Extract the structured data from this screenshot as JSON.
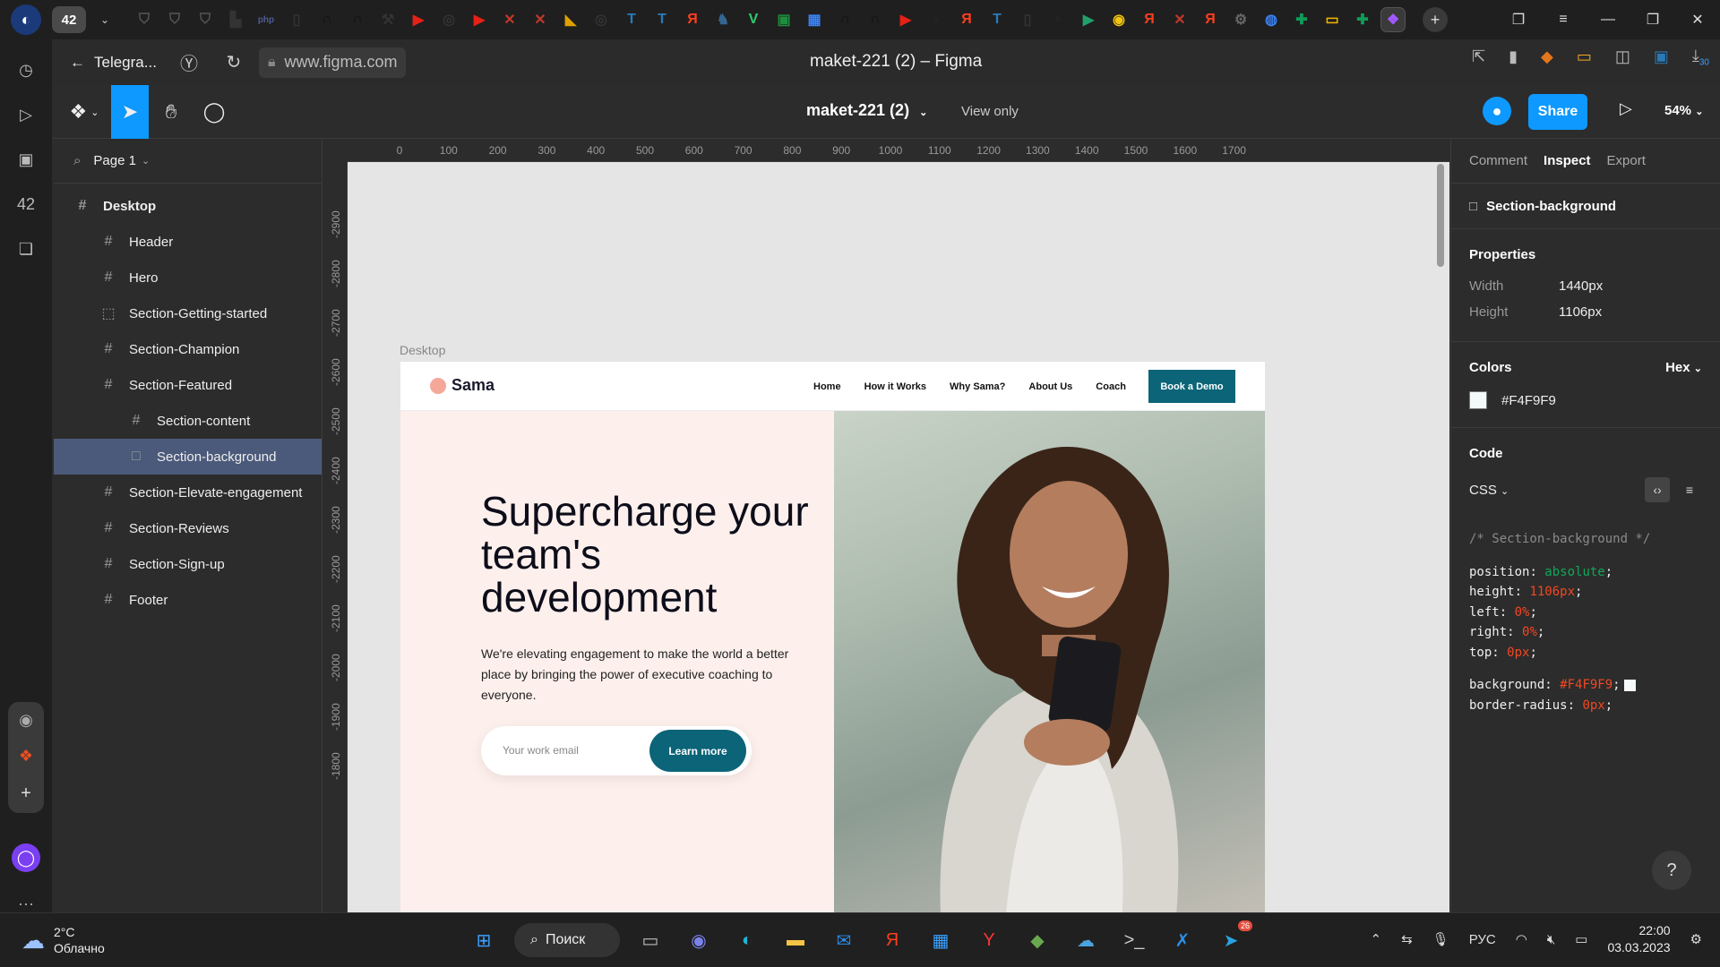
{
  "browser": {
    "tab_count": "42",
    "pinned_tabs": [
      {
        "icon": "shield-icon",
        "glyph": "⛉",
        "color": "#555"
      },
      {
        "icon": "shield-icon",
        "glyph": "⛉",
        "color": "#555"
      },
      {
        "icon": "shield-icon",
        "glyph": "⛉",
        "color": "#555"
      },
      {
        "icon": "chart-icon",
        "glyph": "▙",
        "color": "#333"
      },
      {
        "icon": "php-icon",
        "glyph": "php",
        "color": "#4f5b93"
      },
      {
        "icon": "document-icon",
        "glyph": "▯",
        "color": "#333"
      },
      {
        "icon": "n-icon",
        "glyph": "∩",
        "color": "#111"
      },
      {
        "icon": "n-icon",
        "glyph": "∩",
        "color": "#111"
      },
      {
        "icon": "tool-icon",
        "glyph": "⚒",
        "color": "#333"
      },
      {
        "icon": "youtube-icon",
        "glyph": "▶",
        "color": "#e62117"
      },
      {
        "icon": "circle-icon",
        "glyph": "◎",
        "color": "#333"
      },
      {
        "icon": "youtube-icon",
        "glyph": "▶",
        "color": "#e62117"
      },
      {
        "icon": "figure-icon",
        "glyph": "✕",
        "color": "#c0392b"
      },
      {
        "icon": "figure-icon",
        "glyph": "✕",
        "color": "#c0392b"
      },
      {
        "icon": "chart-icon",
        "glyph": "◣",
        "color": "#e0a000"
      },
      {
        "icon": "circle-icon",
        "glyph": "◎",
        "color": "#333"
      },
      {
        "icon": "t-icon",
        "glyph": "T",
        "color": "#2a7ab8"
      },
      {
        "icon": "t-icon",
        "glyph": "T",
        "color": "#2a7ab8"
      },
      {
        "icon": "yandex-icon",
        "glyph": "Я",
        "color": "#fc3f1d"
      },
      {
        "icon": "elephant-icon",
        "glyph": "♞",
        "color": "#336791"
      },
      {
        "icon": "v-icon",
        "glyph": "V",
        "color": "#2ecc71"
      },
      {
        "icon": "code-icon",
        "glyph": "▣",
        "color": "#1e8e3e"
      },
      {
        "icon": "image-icon",
        "glyph": "▦",
        "color": "#3b82f6"
      },
      {
        "icon": "n-icon",
        "glyph": "∩",
        "color": "#111"
      },
      {
        "icon": "n-icon",
        "glyph": "∩",
        "color": "#111"
      },
      {
        "icon": "youtube-icon",
        "glyph": "▶",
        "color": "#e62117"
      },
      {
        "icon": "github-icon",
        "glyph": "●",
        "color": "#222"
      },
      {
        "icon": "yandex-icon",
        "glyph": "Я",
        "color": "#fc3f1d"
      },
      {
        "icon": "t-icon",
        "glyph": "T",
        "color": "#2a7ab8"
      },
      {
        "icon": "document-icon",
        "glyph": "▯",
        "color": "#333"
      },
      {
        "icon": "github-icon",
        "glyph": "●",
        "color": "#222"
      },
      {
        "icon": "play-icon",
        "glyph": "▶",
        "color": "#22a06b"
      },
      {
        "icon": "coin-icon",
        "glyph": "◉",
        "color": "#f1c40f"
      },
      {
        "icon": "yandex-icon",
        "glyph": "Я",
        "color": "#fc3f1d"
      },
      {
        "icon": "figure-icon",
        "glyph": "✕",
        "color": "#c0392b"
      },
      {
        "icon": "yandex-icon",
        "glyph": "Я",
        "color": "#fc3f1d"
      },
      {
        "icon": "gear-icon",
        "glyph": "⚙",
        "color": "#666"
      },
      {
        "icon": "globe-icon",
        "glyph": "◍",
        "color": "#3b82f6"
      },
      {
        "icon": "sheets-icon",
        "glyph": "✚",
        "color": "#0f9d58"
      },
      {
        "icon": "slides-icon",
        "glyph": "▭",
        "color": "#f4b400"
      },
      {
        "icon": "sheets-icon",
        "glyph": "✚",
        "color": "#0f9d58"
      },
      {
        "icon": "figma-icon",
        "glyph": "❖",
        "color": "#a259ff",
        "active": true
      }
    ],
    "back_tab_label": "Telegra...",
    "url": "www.figma.com",
    "title": "maket-221 (2) – Figma",
    "downloads_badge": "30"
  },
  "figma": {
    "file_name": "maket-221 (2)",
    "mode_label": "View only",
    "share_label": "Share",
    "zoom_label": "54%",
    "page_label": "Page 1",
    "layers": [
      {
        "label": "Desktop",
        "glyph": "#",
        "level": 0
      },
      {
        "label": "Header",
        "glyph": "#",
        "level": 1
      },
      {
        "label": "Hero",
        "glyph": "#",
        "level": 1
      },
      {
        "label": "Section-Getting-started",
        "glyph": "⬚",
        "level": 1
      },
      {
        "label": "Section-Champion",
        "glyph": "#",
        "level": 1
      },
      {
        "label": "Section-Featured",
        "glyph": "#",
        "level": 1
      },
      {
        "label": "Section-content",
        "glyph": "#",
        "level": 2
      },
      {
        "label": "Section-background",
        "glyph": "□",
        "level": 2,
        "selected": true
      },
      {
        "label": "Section-Elevate-engagement",
        "glyph": "#",
        "level": 1
      },
      {
        "label": "Section-Reviews",
        "glyph": "#",
        "level": 1
      },
      {
        "label": "Section-Sign-up",
        "glyph": "#",
        "level": 1
      },
      {
        "label": "Footer",
        "glyph": "#",
        "level": 1
      }
    ],
    "ruler_top": [
      "0",
      "100",
      "200",
      "300",
      "400",
      "500",
      "600",
      "700",
      "800",
      "900",
      "1000",
      "1100",
      "1200",
      "1300",
      "1400",
      "1500",
      "1600",
      "1700"
    ],
    "ruler_left": [
      "-2900",
      "-2800",
      "-2700",
      "-2600",
      "-2500",
      "-2400",
      "-2300",
      "-2200",
      "-2100",
      "-2000",
      "-1900",
      "-1800"
    ],
    "frame_label": "Desktop",
    "inspect": {
      "tabs": [
        "Comment",
        "Inspect",
        "Export"
      ],
      "active_tab": "Inspect",
      "selection_name": "Section-background",
      "properties_title": "Properties",
      "width_label": "Width",
      "width_value": "1440px",
      "height_label": "Height",
      "height_value": "1106px",
      "colors_title": "Colors",
      "color_format": "Hex",
      "color_value": "#F4F9F9",
      "code_title": "Code",
      "code_lang": "CSS",
      "code_comment": "/* Section-background */",
      "code_lines": [
        {
          "prop": "position",
          "val": "absolute",
          "kind": "kw"
        },
        {
          "prop": "height",
          "val": "1106px",
          "kind": "num"
        },
        {
          "prop": "left",
          "val": "0%",
          "kind": "num"
        },
        {
          "prop": "right",
          "val": "0%",
          "kind": "num"
        },
        {
          "prop": "top",
          "val": "0px",
          "kind": "num"
        }
      ],
      "code_lines_2": [
        {
          "prop": "background",
          "val": "#F4F9F9",
          "kind": "num",
          "swatch": true
        },
        {
          "prop": "border-radius",
          "val": "0px",
          "kind": "num"
        }
      ],
      "help_label": "?"
    }
  },
  "site": {
    "logo_text": "Sama",
    "nav": [
      "Home",
      "How it Works",
      "Why Sama?",
      "About Us",
      "Coach"
    ],
    "cta_label": "Book a Demo",
    "headline": "Supercharge your team's development",
    "subtext": "We're elevating engagement to make the world a better place by bringing the power of executive coaching to everyone.",
    "email_placeholder": "Your work email",
    "learn_label": "Learn more"
  },
  "taskbar": {
    "temperature": "2°C",
    "condition": "Облачно",
    "search_label": "Поиск",
    "language": "РУС",
    "time": "22:00",
    "date": "03.03.2023",
    "telegram_badge": "26",
    "apps": [
      {
        "icon": "windows-start-icon",
        "glyph": "⊞",
        "color": "#3aa0ff"
      },
      {
        "icon": "task-view-icon",
        "glyph": "▭",
        "color": "#bbb"
      },
      {
        "icon": "chat-icon",
        "glyph": "◉",
        "color": "#7b83eb"
      },
      {
        "icon": "edge-icon",
        "glyph": "◐",
        "color": "#1fb5d6"
      },
      {
        "icon": "folder-icon",
        "glyph": "▬",
        "color": "#f6c344"
      },
      {
        "icon": "mail-icon",
        "glyph": "✉",
        "color": "#2a8cea"
      },
      {
        "icon": "yandex-icon",
        "glyph": "Я",
        "color": "#fc3f1d"
      },
      {
        "icon": "store-icon",
        "glyph": "▦",
        "color": "#3aa0ff"
      },
      {
        "icon": "yandex-browser-icon",
        "glyph": "Y",
        "color": "#ff3333"
      },
      {
        "icon": "tool-icon",
        "glyph": "◆",
        "color": "#6aa84f"
      },
      {
        "icon": "cloud-icon",
        "glyph": "☁",
        "color": "#4aa3df"
      },
      {
        "icon": "terminal-icon",
        "glyph": ">_",
        "color": "#ccc"
      },
      {
        "icon": "vscode-icon",
        "glyph": "✗",
        "color": "#2c8fe6"
      },
      {
        "icon": "telegram-icon",
        "glyph": "➤",
        "color": "#2aa3e0"
      }
    ]
  }
}
